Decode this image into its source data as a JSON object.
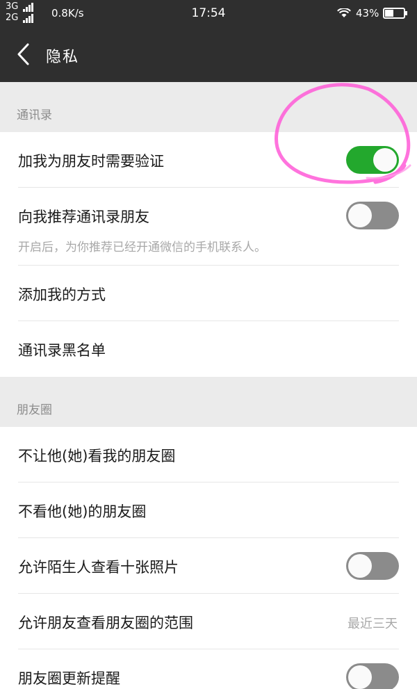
{
  "status_bar": {
    "signal_1": "3G",
    "signal_2": "2G",
    "net_speed": "0.8K/s",
    "time": "17:54",
    "battery": "43%",
    "battery_level": 0.43
  },
  "nav": {
    "title": "隐私",
    "back_icon": "chevron-left-icon"
  },
  "contacts_section": {
    "header": "通讯录",
    "items": [
      {
        "label": "加我为朋友时需要验证",
        "toggle": true
      },
      {
        "label": "向我推荐通讯录朋友",
        "toggle": false
      },
      {
        "label": "添加我的方式"
      },
      {
        "label": "通讯录黑名单"
      }
    ],
    "hint": "开启后，为你推荐已经开通微信的手机联系人。"
  },
  "moments_section": {
    "header": "朋友圈",
    "items": [
      {
        "label": "不让他(她)看我的朋友圈"
      },
      {
        "label": "不看他(她)的朋友圈"
      },
      {
        "label": "允许陌生人查看十张照片",
        "toggle": false
      },
      {
        "label": "允许朋友查看朋友圈的范围",
        "value": "最近三天"
      },
      {
        "label": "朋友圈更新提醒",
        "toggle": false
      }
    ]
  },
  "colors": {
    "toggle_on": "#23a82d",
    "toggle_off": "#8b8b8b",
    "annotation": "#ff5ad7"
  }
}
